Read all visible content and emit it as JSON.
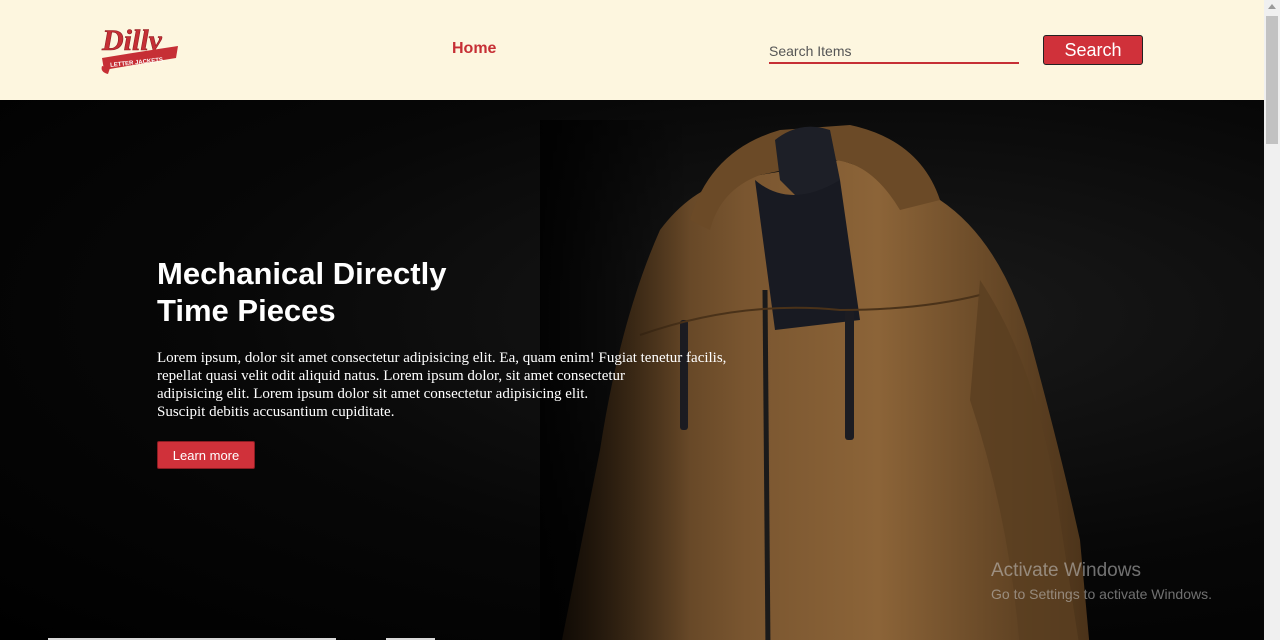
{
  "header": {
    "logo_text": "Dilly",
    "logo_subtext": "LETTER JACKETS",
    "nav_home": "Home",
    "search_placeholder": "Search Items",
    "search_button": "Search"
  },
  "hero": {
    "title_lines": [
      "Mechanical Directly",
      "Time Pieces"
    ],
    "text_lines": [
      "Lorem ipsum, dolor sit amet consectetur adipisicing elit. Ea, quam enim! Fugiat tenetur facilis,",
      "repellat quasi velit odit aliquid natus. Lorem ipsum dolor, sit amet consectetur",
      "adipisicing elit. Lorem ipsum dolor sit amet consectetur adipisicing elit.",
      "Suscipit debitis accusantium cupiditate."
    ],
    "cta": "Learn more",
    "image": "brown-jacket-on-mannequin"
  },
  "watermark": {
    "line1": "Activate Windows",
    "line2": "Go to Settings to activate Windows."
  },
  "colors": {
    "header_bg": "#fdf6df",
    "accent": "#d0313a",
    "hero_bg": "#000000"
  }
}
